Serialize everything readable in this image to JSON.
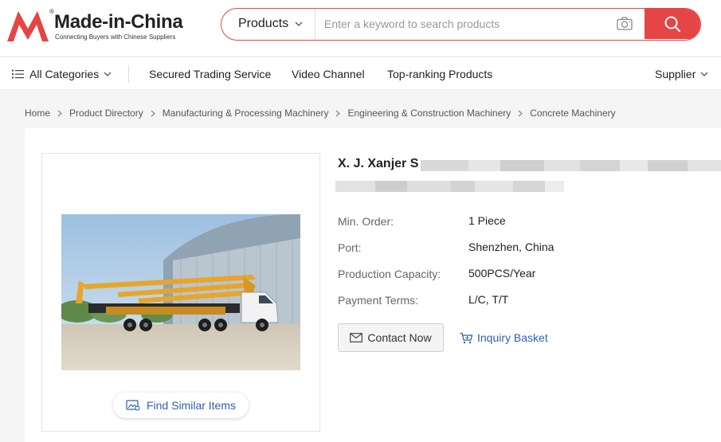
{
  "brand": {
    "name": "Made-in-China",
    "tagline": "Connecting Buyers with Chinese Suppliers",
    "registered": "®",
    "color": "#e64545"
  },
  "search": {
    "category": "Products",
    "placeholder": "Enter a keyword to search products",
    "value": "",
    "camera_icon": "camera-icon",
    "submit_icon": "search-icon"
  },
  "nav": {
    "all_categories": "All Categories",
    "items": [
      "Secured Trading Service",
      "Video Channel",
      "Top-ranking Products"
    ],
    "supplier": "Supplier"
  },
  "breadcrumb": [
    "Home",
    "Product Directory",
    "Manufacturing & Processing Machinery",
    "Engineering & Construction Machinery",
    "Concrete Machinery"
  ],
  "product": {
    "title": "X. J. Xanjer S",
    "image_alt": "Concrete pump truck",
    "find_similar": "Find Similar Items",
    "specs": [
      {
        "label": "Min. Order:",
        "value": "1 Piece"
      },
      {
        "label": "Port:",
        "value": "Shenzhen, China"
      },
      {
        "label": "Production Capacity:",
        "value": "500PCS/Year"
      },
      {
        "label": "Payment Terms:",
        "value": "L/C, T/T"
      }
    ],
    "contact_now": "Contact Now",
    "inquiry_basket": "Inquiry Basket"
  },
  "colors": {
    "accent": "#e64545",
    "link": "#2c5fb3",
    "truck_boom": "#e8a52a"
  }
}
